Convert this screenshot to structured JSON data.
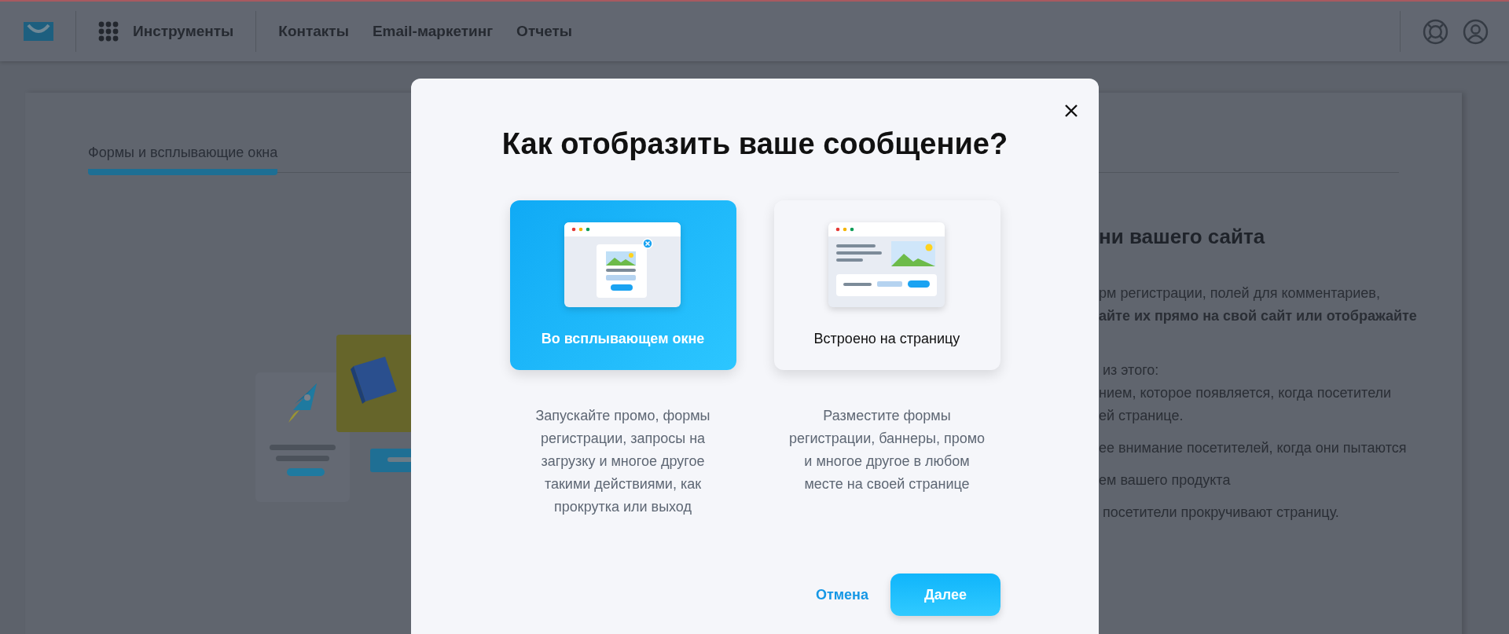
{
  "header": {
    "menu": {
      "label": "Инструменты"
    },
    "nav": [
      {
        "label": "Контакты"
      },
      {
        "label": "Email-маркетинг"
      },
      {
        "label": "Отчеты"
      }
    ]
  },
  "page": {
    "tabs": [
      {
        "label": "Формы и всплывающие окна",
        "selected": true
      }
    ],
    "intro": {
      "heading": "ни вашего сайта",
      "paragraphs": [
        [
          {
            "text": "рм регистрации, полей для комментариев,",
            "bold": false
          },
          {
            "text": "айте их прямо на свой сайт или отображайте",
            "bold": true
          }
        ],
        [
          {
            "text": " из этого:",
            "bold": false
          },
          {
            "text": "нием, которое появляется, когда посетители",
            "bold": false
          },
          {
            "text": "ей странице.",
            "bold": false
          }
        ],
        [
          {
            "text": "ее внимание посетителей, когда они пытаются",
            "bold": false
          }
        ],
        [
          {
            "text": "ем вашего продукта",
            "bold": false
          }
        ],
        [
          {
            "text": " посетители прокручивают страницу.",
            "bold": false
          }
        ]
      ]
    }
  },
  "dialog": {
    "title": "Как отобразить ваше сообщение?",
    "options": [
      {
        "kind": "popup",
        "label": "Во всплывающем окне",
        "description": "Запускайте промо, формы регистрации, запросы на загрузку и многое другое такими действиями, как прокрутка или выход",
        "selected": true
      },
      {
        "kind": "embedded",
        "label": "Встроено на страницу",
        "description": "Разместите формы регистрации, баннеры, промо и многое другое в любом месте на своей странице",
        "selected": false
      }
    ],
    "cancel": "Отмена",
    "next": "Далее"
  }
}
